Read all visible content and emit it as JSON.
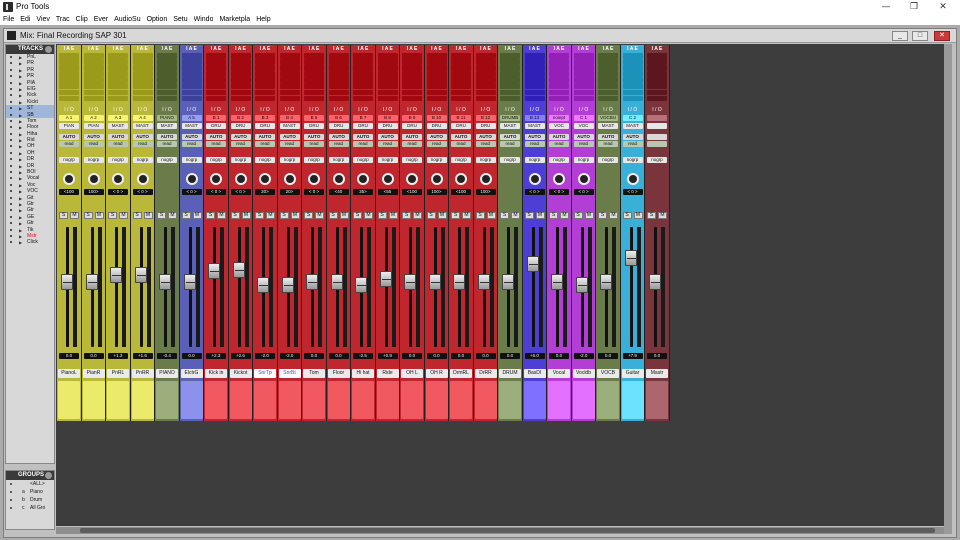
{
  "app": {
    "title": "Pro Tools"
  },
  "window_controls": {
    "minimize": "—",
    "restore": "❐",
    "close": "✕"
  },
  "menus": [
    "File",
    "Edit",
    "View",
    "Track",
    "Clip",
    "Event",
    "AudioSuite",
    "Options",
    "Setup",
    "Window",
    "Marketplace",
    "Help"
  ],
  "menus_visible": [
    "File",
    "Edi",
    "Viev",
    "Trac",
    "Clip",
    "Ever",
    "AudioSu",
    "Option",
    "Setu",
    "Windo",
    "Marketpla",
    "Help"
  ],
  "mix_window": {
    "title": "Mix: Final Recording SAP 301",
    "btn_min": "_",
    "btn_max": "□",
    "btn_close": "✕"
  },
  "tracks_panel": {
    "header": "TRACKS",
    "items": [
      "PnL",
      "PR",
      "PR",
      "PR",
      "PIA",
      "EIG",
      "Kick",
      "Kickt",
      "ST",
      "SB",
      "Tom",
      "Floor",
      "Hiha",
      "Rid",
      "OH",
      "OH",
      "DR",
      "DR",
      "BOI",
      "Vocal",
      "Voc",
      "VOC",
      "Git",
      "Gtr",
      "Gtr",
      "GE",
      "Gtr",
      "Tik",
      "Mstr",
      "Click"
    ]
  },
  "groups_panel": {
    "header": "GROUPS",
    "items": [
      {
        "id": "",
        "label": "<ALL>"
      },
      {
        "id": "a",
        "label": "Piano"
      },
      {
        "id": "b",
        "label": "Drum"
      },
      {
        "id": "c",
        "label": "All Gro"
      }
    ]
  },
  "strips": [
    {
      "name": "PianoL",
      "io": "A 1",
      "output": "PIAN",
      "auto": "AUTO",
      "mode": "read",
      "group": "nogrp",
      "pan": "<100",
      "vol": "0.0",
      "color": "#b9b838"
    },
    {
      "name": "PianR",
      "io": "A 2",
      "output": "PIAN",
      "auto": "AUTO",
      "mode": "read",
      "group": "nogrp",
      "pan": "100>",
      "vol": "0.0",
      "color": "#b9b838"
    },
    {
      "name": "PnRL",
      "io": "A 3",
      "output": "MAST",
      "auto": "AUTO",
      "mode": "read",
      "group": "nogrp",
      "pan": "< 0 >",
      "vol": "+1.3",
      "color": "#b9b838"
    },
    {
      "name": "PnRR",
      "io": "A 4",
      "output": "MAST",
      "auto": "AUTO",
      "mode": "read",
      "group": "nogrp",
      "pan": "< 0 >",
      "vol": "+1.6",
      "color": "#b9b838"
    },
    {
      "name": "PIANO",
      "io": "PIANO",
      "output": "MAST",
      "auto": "AUTO",
      "mode": "read",
      "group": "nogrp",
      "pan": "",
      "vol": "-0.4",
      "color": "#6b7c4b"
    },
    {
      "name": "ElctrG",
      "io": "A 5",
      "output": "MAST",
      "auto": "AUTO",
      "mode": "read",
      "group": "nogrp",
      "pan": "< 0 >",
      "vol": "0.0",
      "color": "#5a5fb8"
    },
    {
      "name": "Kick in",
      "io": "B 1",
      "output": "DRU",
      "auto": "AUTO",
      "mode": "read",
      "group": "nogrp",
      "pan": "< 0 >",
      "vol": "+2.3",
      "color": "#c0262d"
    },
    {
      "name": "Kickot",
      "io": "B 2",
      "output": "DRU",
      "auto": "AUTO",
      "mode": "read",
      "group": "nogrp",
      "pan": "< 0 >",
      "vol": "+2.6",
      "color": "#c0262d"
    },
    {
      "name": "SnrTp",
      "io": "B 3",
      "output": "DRU",
      "auto": "AUTO",
      "mode": "read",
      "group": "nogrp",
      "pan": "20>",
      "vol": "-2.0",
      "color": "#c0262d",
      "selected": true
    },
    {
      "name": "SnrBt",
      "io": "B 4",
      "output": "MAST",
      "auto": "AUTO",
      "mode": "read",
      "group": "nogrp",
      "pan": "20>",
      "vol": "-2.0",
      "color": "#c0262d",
      "selected": true
    },
    {
      "name": "Tom",
      "io": "B 5",
      "output": "DRU",
      "auto": "AUTO",
      "mode": "read",
      "group": "nogrp",
      "pan": "< 0 >",
      "vol": "0.0",
      "color": "#c0262d"
    },
    {
      "name": "Floor",
      "io": "B 6",
      "output": "DRU",
      "auto": "AUTO",
      "mode": "read",
      "group": "nogrp",
      "pan": "<40",
      "vol": "0.0",
      "color": "#c0262d"
    },
    {
      "name": "Hi hat",
      "io": "B 7",
      "output": "DRU",
      "auto": "AUTO",
      "mode": "read",
      "group": "nogrp",
      "pan": "35>",
      "vol": "-2.5",
      "color": "#c0262d"
    },
    {
      "name": "Ride",
      "io": "B 8",
      "output": "DRU",
      "auto": "AUTO",
      "mode": "read",
      "group": "nogrp",
      "pan": "<55",
      "vol": "+0.9",
      "color": "#c0262d"
    },
    {
      "name": "OH L",
      "io": "B 9",
      "output": "DRU",
      "auto": "AUTO",
      "mode": "read",
      "group": "nogrp",
      "pan": "<100",
      "vol": "0.0",
      "color": "#c0262d"
    },
    {
      "name": "OH R",
      "io": "B 10",
      "output": "DRU",
      "auto": "AUTO",
      "mode": "read",
      "group": "nogrp",
      "pan": "100>",
      "vol": "0.0",
      "color": "#c0262d"
    },
    {
      "name": "DrmRL",
      "io": "B 11",
      "output": "DRU",
      "auto": "AUTO",
      "mode": "read",
      "group": "nogrp",
      "pan": "<100",
      "vol": "0.0",
      "color": "#c0262d"
    },
    {
      "name": "DrRR",
      "io": "B 12",
      "output": "DRU",
      "auto": "AUTO",
      "mode": "read",
      "group": "nogrp",
      "pan": "100>",
      "vol": "0.0",
      "color": "#c0262d"
    },
    {
      "name": "DRUM",
      "io": "DRUMB",
      "output": "MAST",
      "auto": "AUTO",
      "mode": "read",
      "group": "nogrp",
      "pan": "",
      "vol": "0.0",
      "color": "#6b7c4b"
    },
    {
      "name": "BasDI",
      "io": "B 13",
      "output": "MAST",
      "auto": "AUTO",
      "mode": "read",
      "group": "nogrp",
      "pan": "< 0 >",
      "vol": "+6.0",
      "color": "#4d3ed6"
    },
    {
      "name": "Vocal",
      "io": "noinpt",
      "output": "VOC",
      "auto": "AUTO",
      "mode": "read",
      "group": "nogrp",
      "pan": "< 0 >",
      "vol": "0.0",
      "color": "#b23ed6"
    },
    {
      "name": "Vocldb",
      "io": "C 1",
      "output": "VOC",
      "auto": "AUTO",
      "mode": "read",
      "group": "nogrp",
      "pan": "< 0 >",
      "vol": "-2.0",
      "color": "#b23ed6"
    },
    {
      "name": "VOCB",
      "io": "VOCBU",
      "output": "MAST",
      "auto": "AUTO",
      "mode": "read",
      "group": "nogrp",
      "pan": "",
      "vol": "0.0",
      "color": "#6b7c4b"
    },
    {
      "name": "Guitar",
      "io": "C 2",
      "output": "MAST",
      "auto": "AUTO",
      "mode": "read",
      "group": "nogrp",
      "pan": "< 0 >",
      "vol": "+7.9",
      "color": "#3ab0d8"
    },
    {
      "name": "Mastr",
      "io": "",
      "output": "",
      "auto": "",
      "mode": "",
      "group": "nogrp",
      "pan": "",
      "vol": "0.0",
      "color": "#7a343c"
    }
  ],
  "fader_levels": [
    0.55,
    0.55,
    0.62,
    0.62,
    0.55,
    0.55,
    0.65,
    0.66,
    0.52,
    0.52,
    0.55,
    0.55,
    0.52,
    0.58,
    0.55,
    0.55,
    0.55,
    0.55,
    0.55,
    0.72,
    0.55,
    0.52,
    0.55,
    0.78,
    0.55
  ],
  "strip_labels": {
    "iae": "I A E",
    "io_label": "I / O",
    "solo": "S",
    "mute": "M"
  }
}
